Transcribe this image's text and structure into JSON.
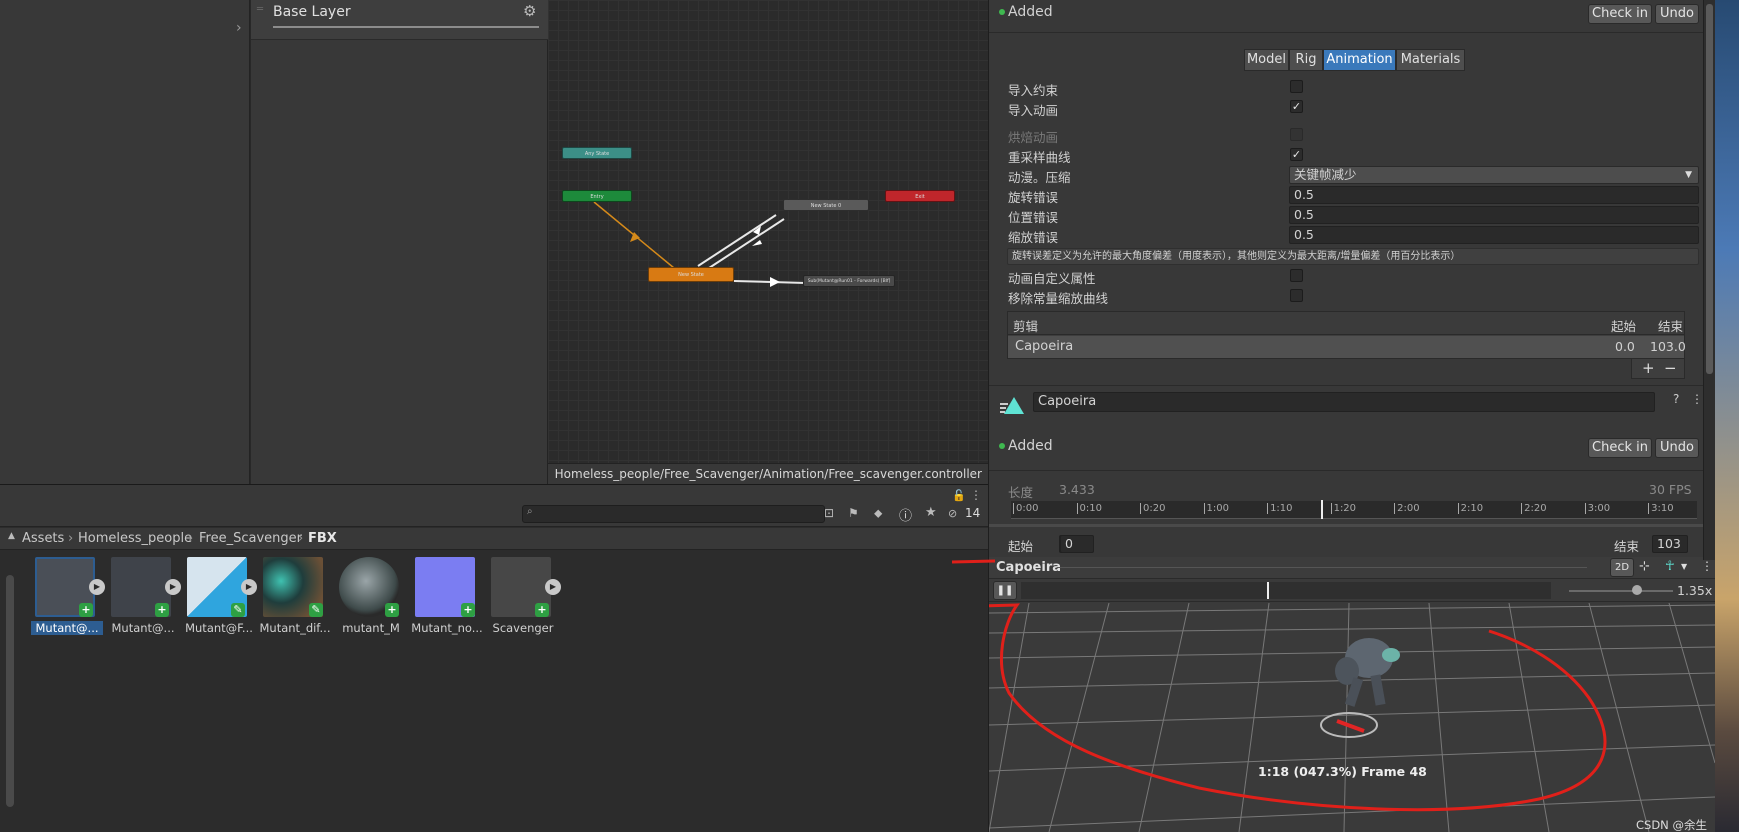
{
  "animator": {
    "layer_title": "Base Layer",
    "controller_path": "Homeless_people/Free_Scavenger/Animation/Free_scavenger.controller",
    "nodes": {
      "any_state": "Any State",
      "entry": "Entry",
      "exit": "Exit",
      "state0": "New State 0",
      "new_state": "New State",
      "blend": "Sub(Mutant@Run01 - Forwards) [Blf]"
    }
  },
  "inspector": {
    "status": "Added",
    "check_in": "Check in",
    "undo": "Undo",
    "tabs": [
      "Model",
      "Rig",
      "Animation",
      "Materials"
    ],
    "active_tab": "Animation",
    "rows": {
      "import_constraints": "导入约束",
      "import_animation": "导入动画",
      "bake_animation": "烘焙动画",
      "resample_curves": "重采样曲线",
      "anim_compression": "动漫。压缩",
      "rotation_error": "旋转错误",
      "position_error": "位置错误",
      "scale_error": "缩放错误",
      "anim_custom_props": "动画自定义属性",
      "remove_const_scale": "移除常量缩放曲线"
    },
    "compression_value": "关键帧减少",
    "rotation_error_value": "0.5",
    "position_error_value": "0.5",
    "scale_error_value": "0.5",
    "help_text": "旋转误差定义为允许的最大角度偏差（用度表示），其他则定义为最大距离/增量偏差（用百分比表示）",
    "clips": {
      "header": "剪辑",
      "start_col": "起始",
      "end_col": "结束",
      "clip_name": "Capoeira",
      "clip_start": "0.0",
      "clip_end": "103.0"
    },
    "clip_field": "Capoeira",
    "status2": "Added",
    "timeline": {
      "length_label": "长度",
      "length_value": "3.433",
      "fps": "30 FPS",
      "ticks": [
        "0:00",
        "0:10",
        "0:20",
        "1:00",
        "1:10",
        "1:20",
        "2:00",
        "2:10",
        "2:20",
        "3:00",
        "3:10"
      ]
    },
    "start_label": "起始",
    "start_value": "0",
    "end_label": "结束",
    "end_value": "103"
  },
  "preview": {
    "title": "Capoeira",
    "mode_2d": "2D",
    "speed": "1.35x",
    "frame_info": "1:18 (047.3%) Frame 48",
    "watermark": "CSDN @余生tt"
  },
  "project": {
    "breadcrumb": [
      "Assets",
      "Homeless_people",
      "Free_Scavenger",
      "FBX"
    ],
    "hidden_count": "14",
    "assets": [
      {
        "label": "Mutant@..."
      },
      {
        "label": "Mutant@..."
      },
      {
        "label": "Mutant@F..."
      },
      {
        "label": "Mutant_dif..."
      },
      {
        "label": "mutant_M"
      },
      {
        "label": "Mutant_no..."
      },
      {
        "label": "Scavenger"
      }
    ]
  },
  "colors": {
    "accent": "#3a79bb",
    "annotation": "#e0201a",
    "entry": "#1d8a3b",
    "exit": "#c0262b",
    "any_state": "#3c8f87",
    "default_state": "#d87a13"
  }
}
